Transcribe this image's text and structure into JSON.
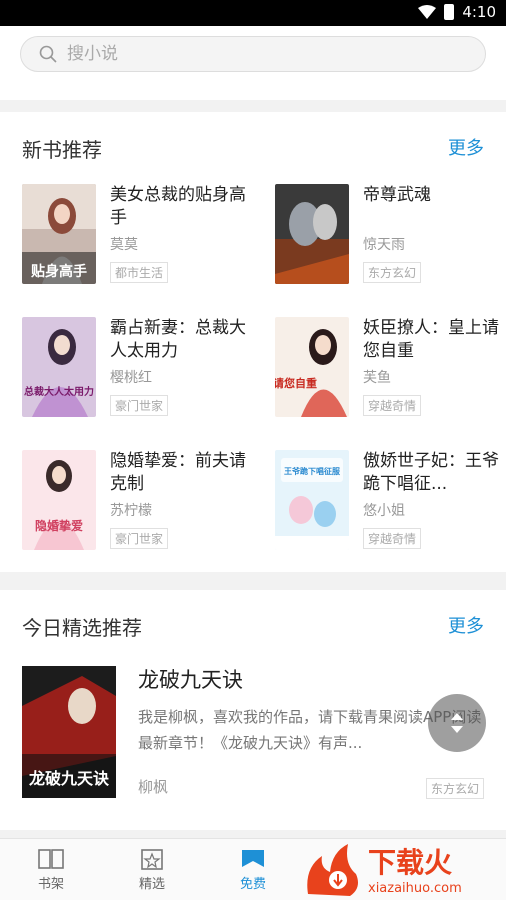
{
  "status": {
    "time": "4:10"
  },
  "search": {
    "placeholder": "搜小说"
  },
  "new_books": {
    "title": "新书推荐",
    "more": "更多",
    "books": [
      {
        "title": "美女总裁的贴身高手",
        "author": "莫莫",
        "tag": "都市生活",
        "cover_text": "贴身高手"
      },
      {
        "title": "帝尊武魂",
        "author": "惊天雨",
        "tag": "东方玄幻",
        "cover_text": ""
      },
      {
        "title": "霸占新妻：总裁大人太用力",
        "author": "樱桃红",
        "tag": "豪门世家",
        "cover_text": "总裁大人太用力"
      },
      {
        "title": "妖臣撩人：皇上请您自重",
        "author": "芙鱼",
        "tag": "穿越奇情",
        "cover_text": "请您自重"
      },
      {
        "title": "隐婚挚爱：前夫请克制",
        "author": "苏柠檬",
        "tag": "豪门世家",
        "cover_text": "隐婚挚爱"
      },
      {
        "title": "傲娇世子妃：王爷跪下唱征...",
        "author": "悠小姐",
        "tag": "穿越奇情",
        "cover_text": "王爷跪下唱征服"
      }
    ]
  },
  "today_picks": {
    "title": "今日精选推荐",
    "more": "更多",
    "book": {
      "title": "龙破九天诀",
      "description": "我是柳枫，喜欢我的作品，请下载青果阅读APP阅读最新章节！《龙破九天诀》有声...",
      "author": "柳枫",
      "tag": "东方玄幻",
      "cover_text": "龙破九天诀"
    }
  },
  "tabs": [
    {
      "label": "书架"
    },
    {
      "label": "精选"
    },
    {
      "label": "免费"
    }
  ],
  "watermark": {
    "brand": "下载火",
    "url": "xiazaihuo.com"
  },
  "colors": {
    "accent": "#1e90d6",
    "watermark": "#e8421c"
  }
}
